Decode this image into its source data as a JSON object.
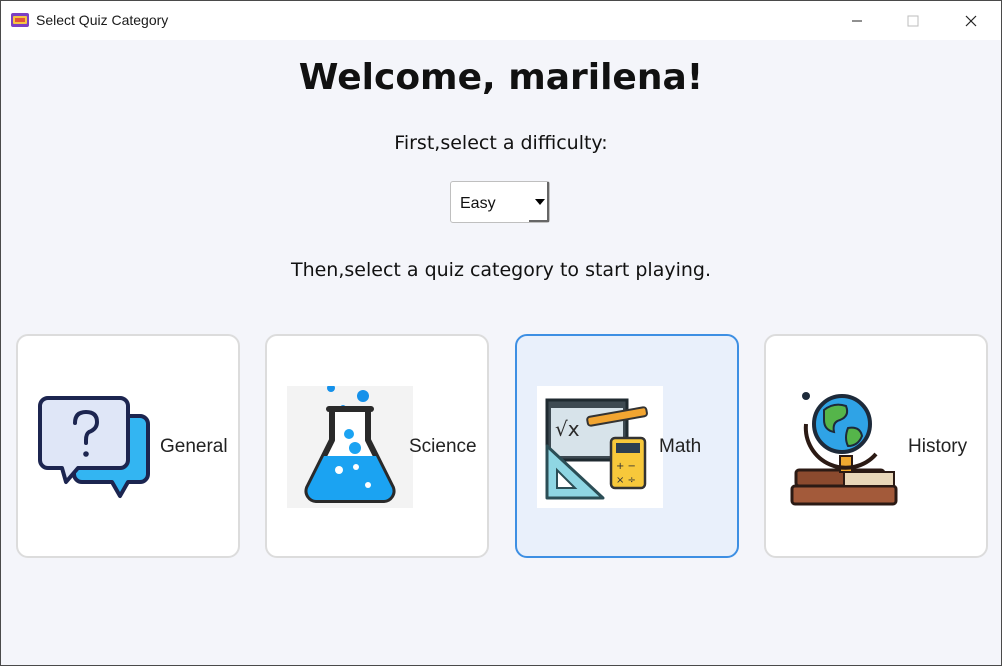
{
  "window": {
    "title": "Select Quiz Category",
    "app_icon": "quiz-app-icon"
  },
  "main": {
    "welcome": "Welcome, marilena!",
    "subtitle": "First,select a difficulty:",
    "difficulty": {
      "selected": "Easy"
    },
    "instruction": "Then,select a quiz category to start playing."
  },
  "categories": [
    {
      "label": "General",
      "icon": "question-chat-icon",
      "selected": false
    },
    {
      "label": "Science",
      "icon": "flask-icon",
      "selected": false
    },
    {
      "label": "Math",
      "icon": "math-tools-icon",
      "selected": true
    },
    {
      "label": "History",
      "icon": "globe-books-icon",
      "selected": false
    }
  ],
  "colors": {
    "background": "#f4f5fa",
    "selected_border": "#3d8fe3",
    "selected_fill": "#e9f0fb"
  }
}
